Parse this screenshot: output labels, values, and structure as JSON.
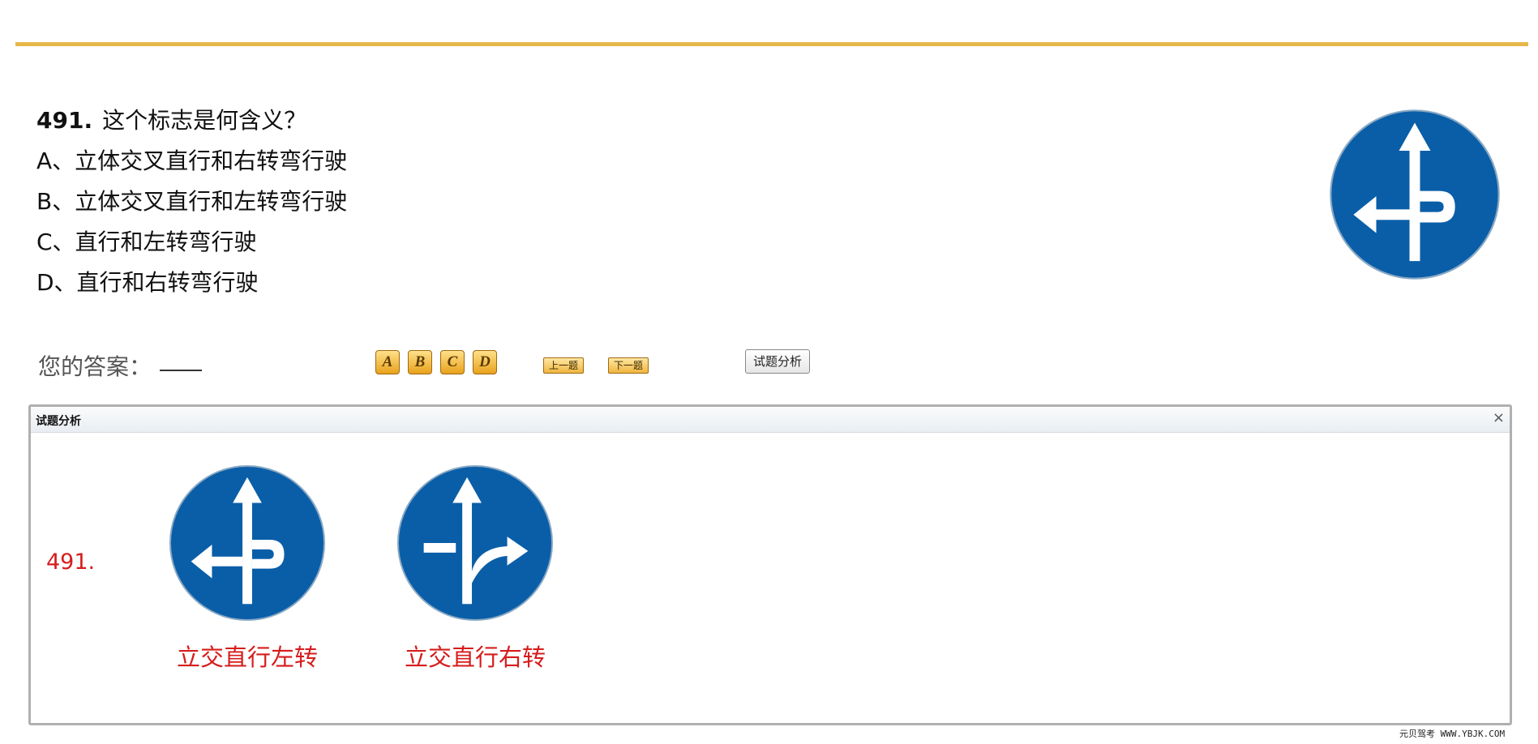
{
  "question": {
    "number": "491.",
    "text": "这个标志是何含义？",
    "options": [
      "A、立体交叉直行和右转弯行驶",
      "B、立体交叉直行和左转弯行驶",
      "C、直行和左转弯行驶",
      "D、直行和右转弯行驶"
    ],
    "sign_icon": "straight-and-left-overpass-sign"
  },
  "answer": {
    "label": "您的答案：",
    "value": ""
  },
  "controls": {
    "choices": [
      "A",
      "B",
      "C",
      "D"
    ],
    "prev": "上一题",
    "next": "下一题",
    "analysis": "试题分析"
  },
  "panel": {
    "title": "试题分析",
    "close": "×",
    "number": "491.",
    "signs": [
      {
        "caption": "立交直行左转",
        "icon": "straight-and-left-overpass-sign"
      },
      {
        "caption": "立交直行右转",
        "icon": "straight-and-right-overpass-sign"
      }
    ]
  },
  "footer": "元贝驾考 WWW.YBJK.COM",
  "colors": {
    "accent_rule": "#e6b84a",
    "sign_blue": "#0a5ea8",
    "caption_red": "#d61c1c"
  }
}
